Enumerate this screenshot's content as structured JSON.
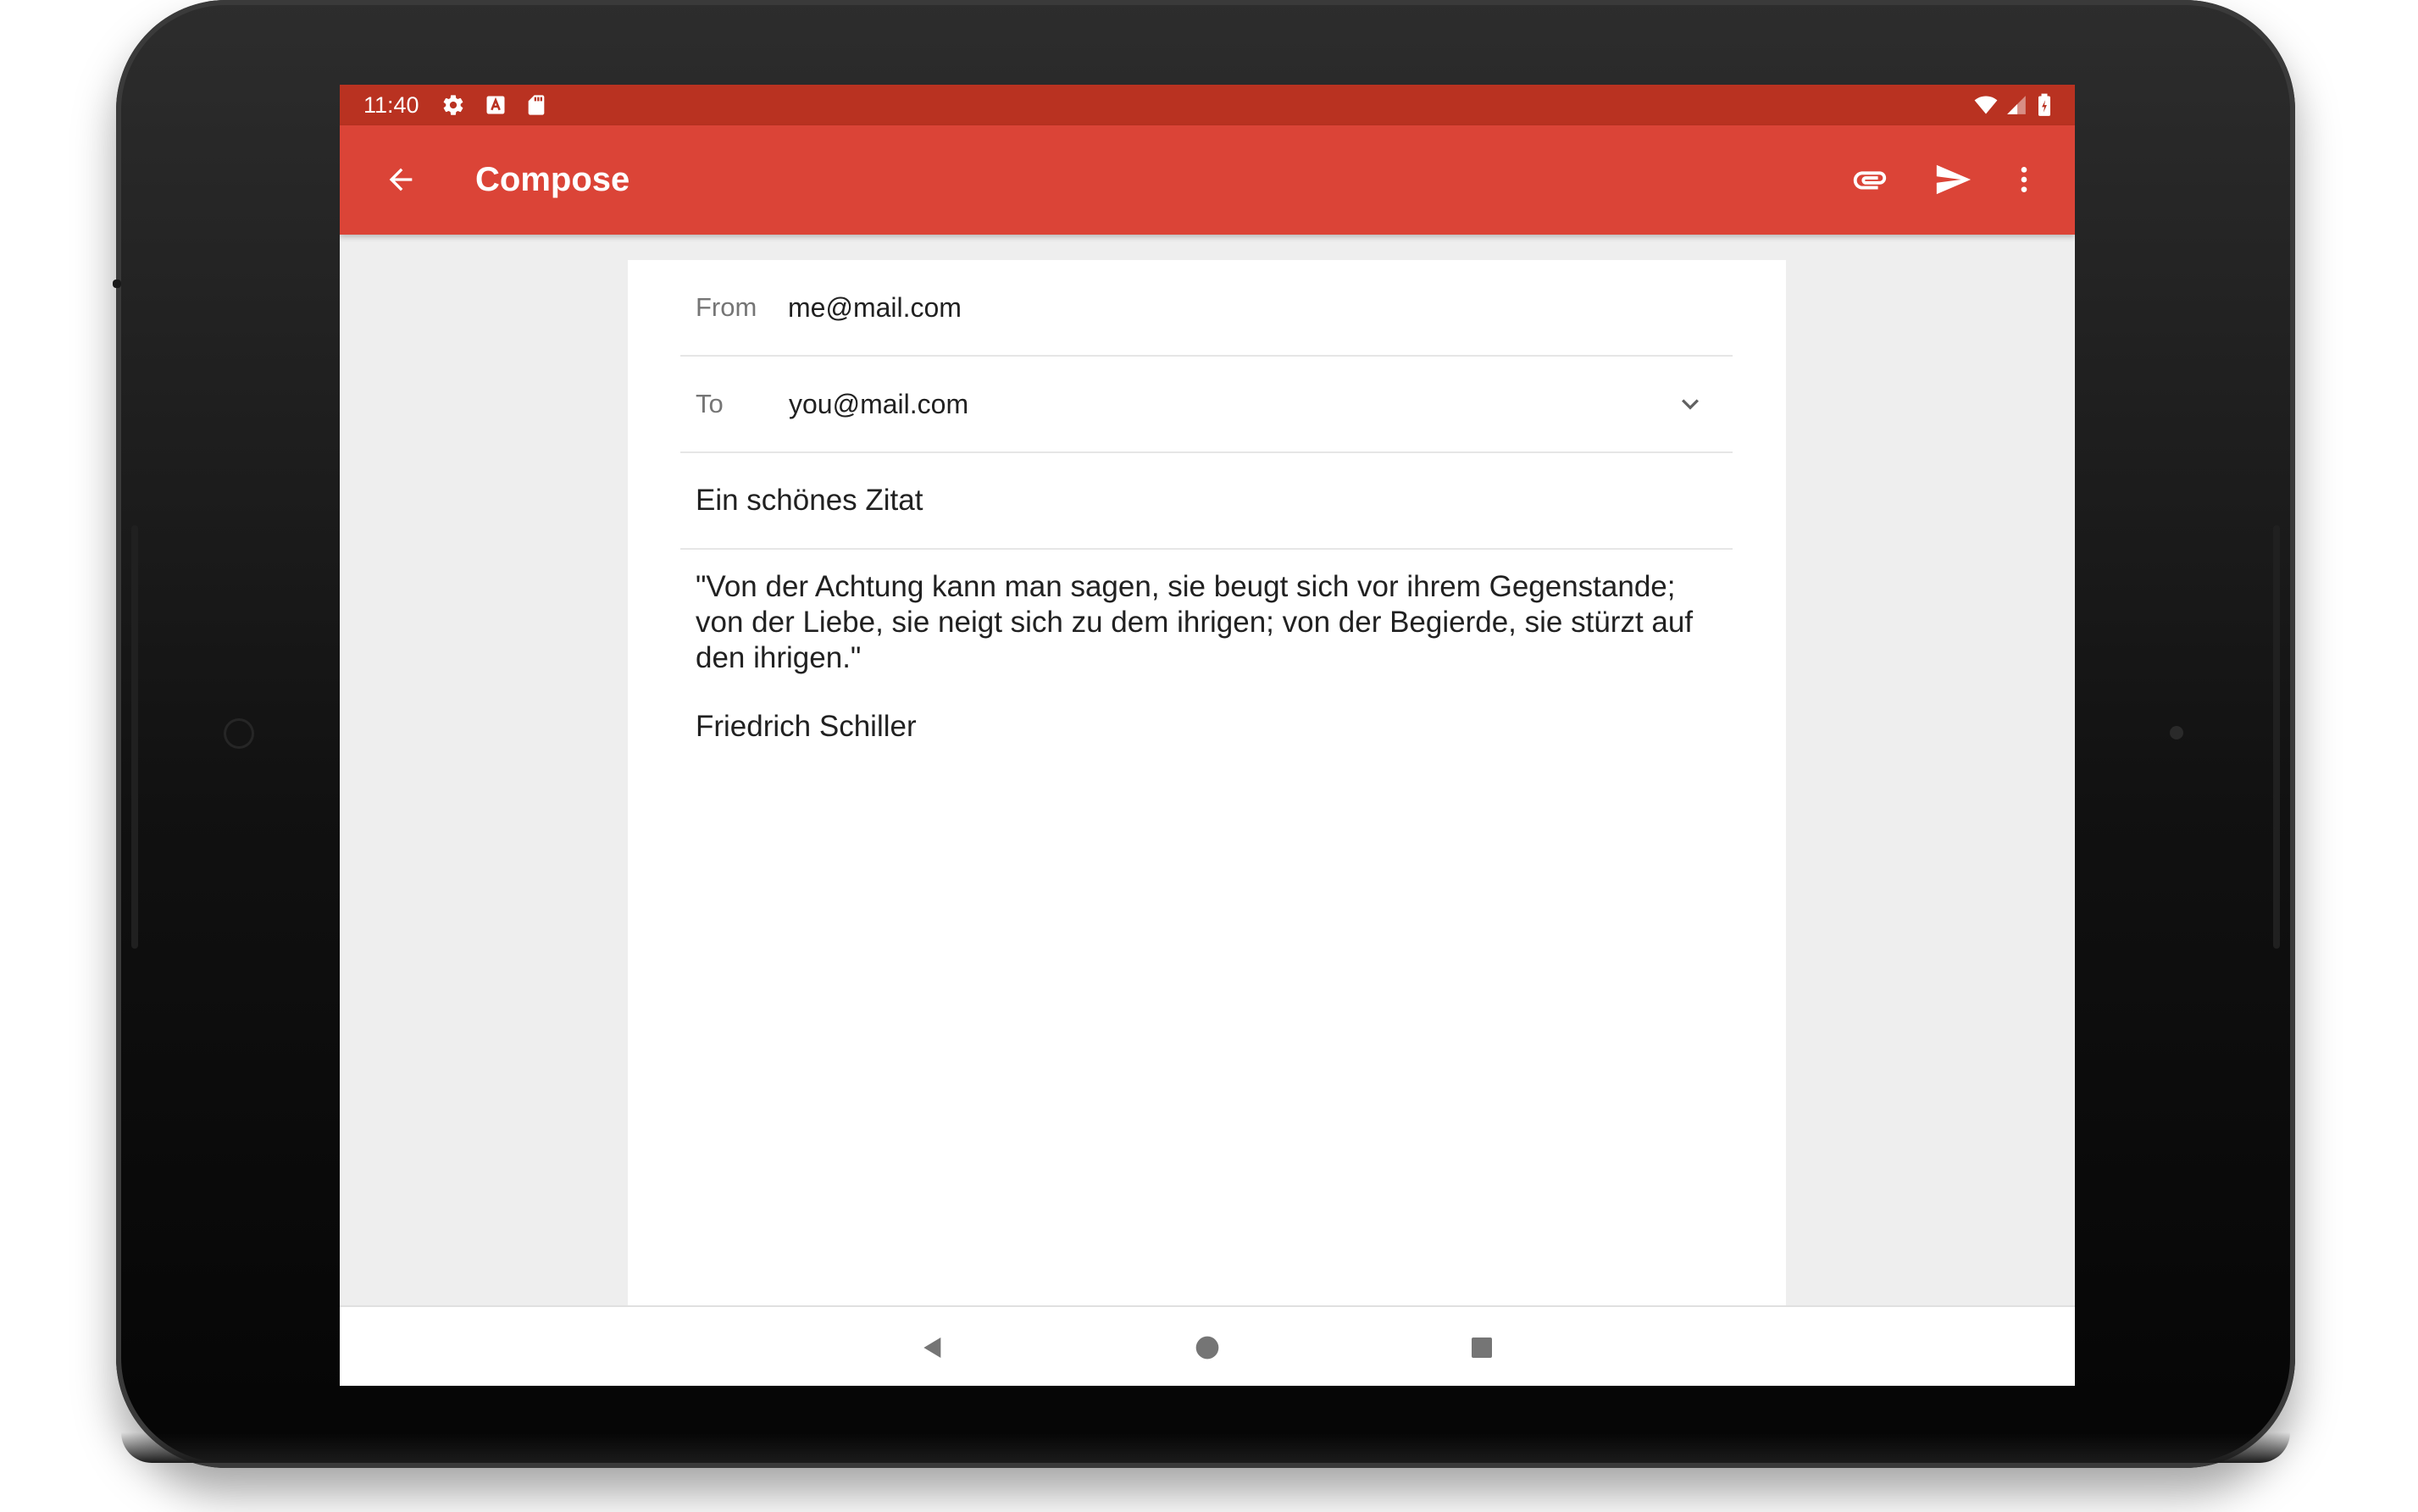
{
  "status_bar": {
    "time": "11:40",
    "left_icons": [
      "gear-icon",
      "keyboard-a-icon",
      "sd-card-icon"
    ],
    "right_icons": [
      "wifi-icon",
      "signal-icon",
      "battery-charging-icon"
    ]
  },
  "app_bar": {
    "title": "Compose",
    "actions": [
      "attach-icon",
      "send-icon",
      "more-vert-icon"
    ]
  },
  "compose": {
    "from_label": "From",
    "from_value": "me@mail.com",
    "to_label": "To",
    "to_value": "you@mail.com",
    "subject": "Ein schönes Zitat",
    "body": "\"Von der Achtung kann man sagen, sie beugt sich vor ihrem Gegenstande;\nvon der Liebe, sie neigt sich zu dem ihrigen; von der Begierde, sie stürzt auf\nden ihrigen.\"",
    "signature": "Friedrich Schiller"
  },
  "colors": {
    "status_bar": "#b93221",
    "app_bar": "#db4437",
    "background": "#eeeeee",
    "card": "#ffffff"
  }
}
